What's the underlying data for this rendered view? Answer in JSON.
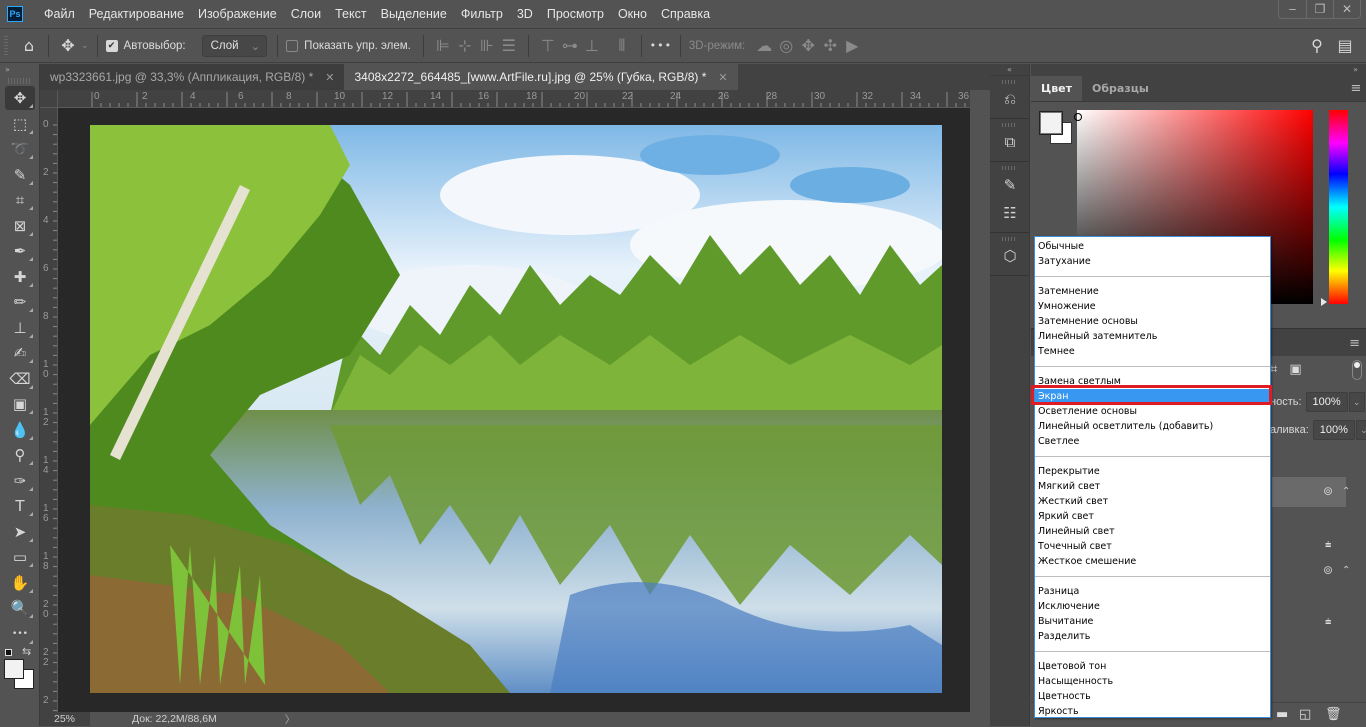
{
  "app": {
    "logo": "Ps"
  },
  "menu": [
    "Файл",
    "Редактирование",
    "Изображение",
    "Слои",
    "Текст",
    "Выделение",
    "Фильтр",
    "3D",
    "Просмотр",
    "Окно",
    "Справка"
  ],
  "window_controls": {
    "minimize": "‒",
    "restore": "❐",
    "close": "✕"
  },
  "options_bar": {
    "autoselect_label": "Автовыбор:",
    "autoselect_checked": true,
    "autoselect_value": "Слой",
    "show_controls_label": "Показать упр. элем.",
    "show_controls_checked": false,
    "mode3d_label": "3D-режим:",
    "more": "•••"
  },
  "tabs": [
    {
      "label": "wp3323661.jpg @ 33,3% (Аппликация, RGB/8) *",
      "close": "✕",
      "active": false
    },
    {
      "label": "3408x2272_664485_[www.ArtFile.ru].jpg @ 25% (Губка, RGB/8) *",
      "close": "✕",
      "active": true
    }
  ],
  "ruler_top": [
    "0",
    "2",
    "4",
    "6",
    "8",
    "10",
    "12",
    "14",
    "16",
    "18",
    "20",
    "22",
    "24",
    "26",
    "28",
    "30",
    "32",
    "34",
    "36"
  ],
  "ruler_left": [
    "0",
    "2",
    "4",
    "6",
    "8",
    "10",
    "12",
    "14",
    "16",
    "18",
    "20",
    "22",
    "2"
  ],
  "tools": [
    {
      "name": "move-tool",
      "glyph": "✥"
    },
    {
      "name": "marquee-tool",
      "glyph": "⬚"
    },
    {
      "name": "lasso-tool",
      "glyph": "➰"
    },
    {
      "name": "quick-selection-tool",
      "glyph": "✎"
    },
    {
      "name": "crop-tool",
      "glyph": "⌗"
    },
    {
      "name": "frame-tool",
      "glyph": "⊠"
    },
    {
      "name": "eyedropper-tool",
      "glyph": "✒"
    },
    {
      "name": "healing-brush-tool",
      "glyph": "✚"
    },
    {
      "name": "brush-tool",
      "glyph": "✏"
    },
    {
      "name": "clone-stamp-tool",
      "glyph": "⊥"
    },
    {
      "name": "history-brush-tool",
      "glyph": "✍"
    },
    {
      "name": "eraser-tool",
      "glyph": "⌫"
    },
    {
      "name": "gradient-tool",
      "glyph": "▣"
    },
    {
      "name": "blur-tool",
      "glyph": "💧"
    },
    {
      "name": "dodge-tool",
      "glyph": "⚲"
    },
    {
      "name": "pen-tool",
      "glyph": "✑"
    },
    {
      "name": "type-tool",
      "glyph": "T"
    },
    {
      "name": "path-selection-tool",
      "glyph": "➤"
    },
    {
      "name": "rectangle-tool",
      "glyph": "▭"
    },
    {
      "name": "hand-tool",
      "glyph": "✋"
    },
    {
      "name": "zoom-tool",
      "glyph": "🔍"
    },
    {
      "name": "more-tools",
      "glyph": "•••"
    }
  ],
  "status": {
    "zoom": "25%",
    "doc": "Док: 22,2M/88,6M",
    "arrow": "〉"
  },
  "color_panel": {
    "tabs": [
      "Цвет",
      "Образцы"
    ],
    "foreground": "#f2f2f2",
    "background": "#ffffff",
    "hue_color": "#ff0000"
  },
  "layers": {
    "opacity_label": "ность:",
    "opacity_value": "100%",
    "fill_label": "аливка:",
    "fill_value": "100%"
  },
  "blend_modes": {
    "groups": [
      [
        "Обычные",
        "Затухание"
      ],
      [
        "Затемнение",
        "Умножение",
        "Затемнение основы",
        "Линейный затемнитель",
        "Темнее"
      ],
      [
        "Замена светлым",
        "Экран",
        "Осветление основы",
        "Линейный осветлитель (добавить)",
        "Светлее"
      ],
      [
        "Перекрытие",
        "Мягкий свет",
        "Жесткий свет",
        "Яркий свет",
        "Линейный свет",
        "Точечный свет",
        "Жесткое смешение"
      ],
      [
        "Разница",
        "Исключение",
        "Вычитание",
        "Разделить"
      ],
      [
        "Цветовой тон",
        "Насыщенность",
        "Цветность",
        "Яркость"
      ]
    ],
    "highlighted": "Экран",
    "highlight_color": "#3897f0",
    "annotation_color": "#e01b24"
  }
}
